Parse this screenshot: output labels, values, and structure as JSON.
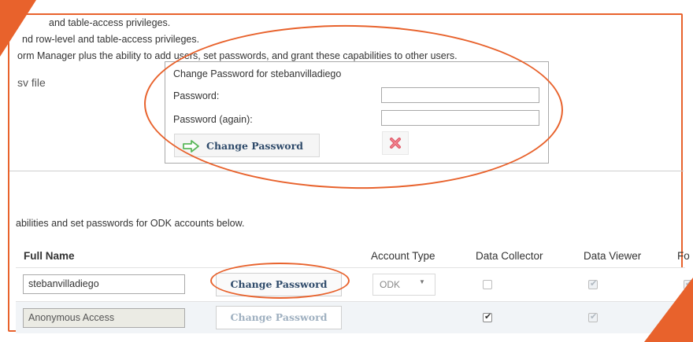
{
  "privileges": {
    "line1": "and table-access privileges.",
    "line2": "nd row-level and table-access privileges.",
    "line3": "orm Manager plus the ability to add users, set passwords, and grant these capabilities to other users."
  },
  "csv_label": "sv file",
  "dialog": {
    "title": "Change Password for stebanvilladiego",
    "password_label": "Password:",
    "password_again_label": "Password (again):",
    "password_value": "",
    "password_again_value": "",
    "change_button": "Change Password",
    "cancel_icon": "red-x-icon"
  },
  "intro_text": "abilities and set passwords for ODK accounts below.",
  "table": {
    "headers": {
      "full_name": "Full Name",
      "account_type": "Account Type",
      "data_collector": "Data Collector",
      "data_viewer": "Data Viewer",
      "form_manager": "Fo"
    },
    "rows": [
      {
        "full_name": "stebanvilladiego",
        "change_password": "Change Password",
        "account_type": "ODK",
        "data_collector": false,
        "data_viewer": true,
        "form_manager": true
      },
      {
        "full_name": "Anonymous Access",
        "change_password": "Change Password",
        "account_type": "",
        "data_collector": true,
        "data_viewer": true
      }
    ]
  },
  "colors": {
    "annotation": "#e8622c",
    "button_text": "#2e4a6a",
    "arrow": "#5cb85c",
    "cancel": "#e05a6a"
  }
}
